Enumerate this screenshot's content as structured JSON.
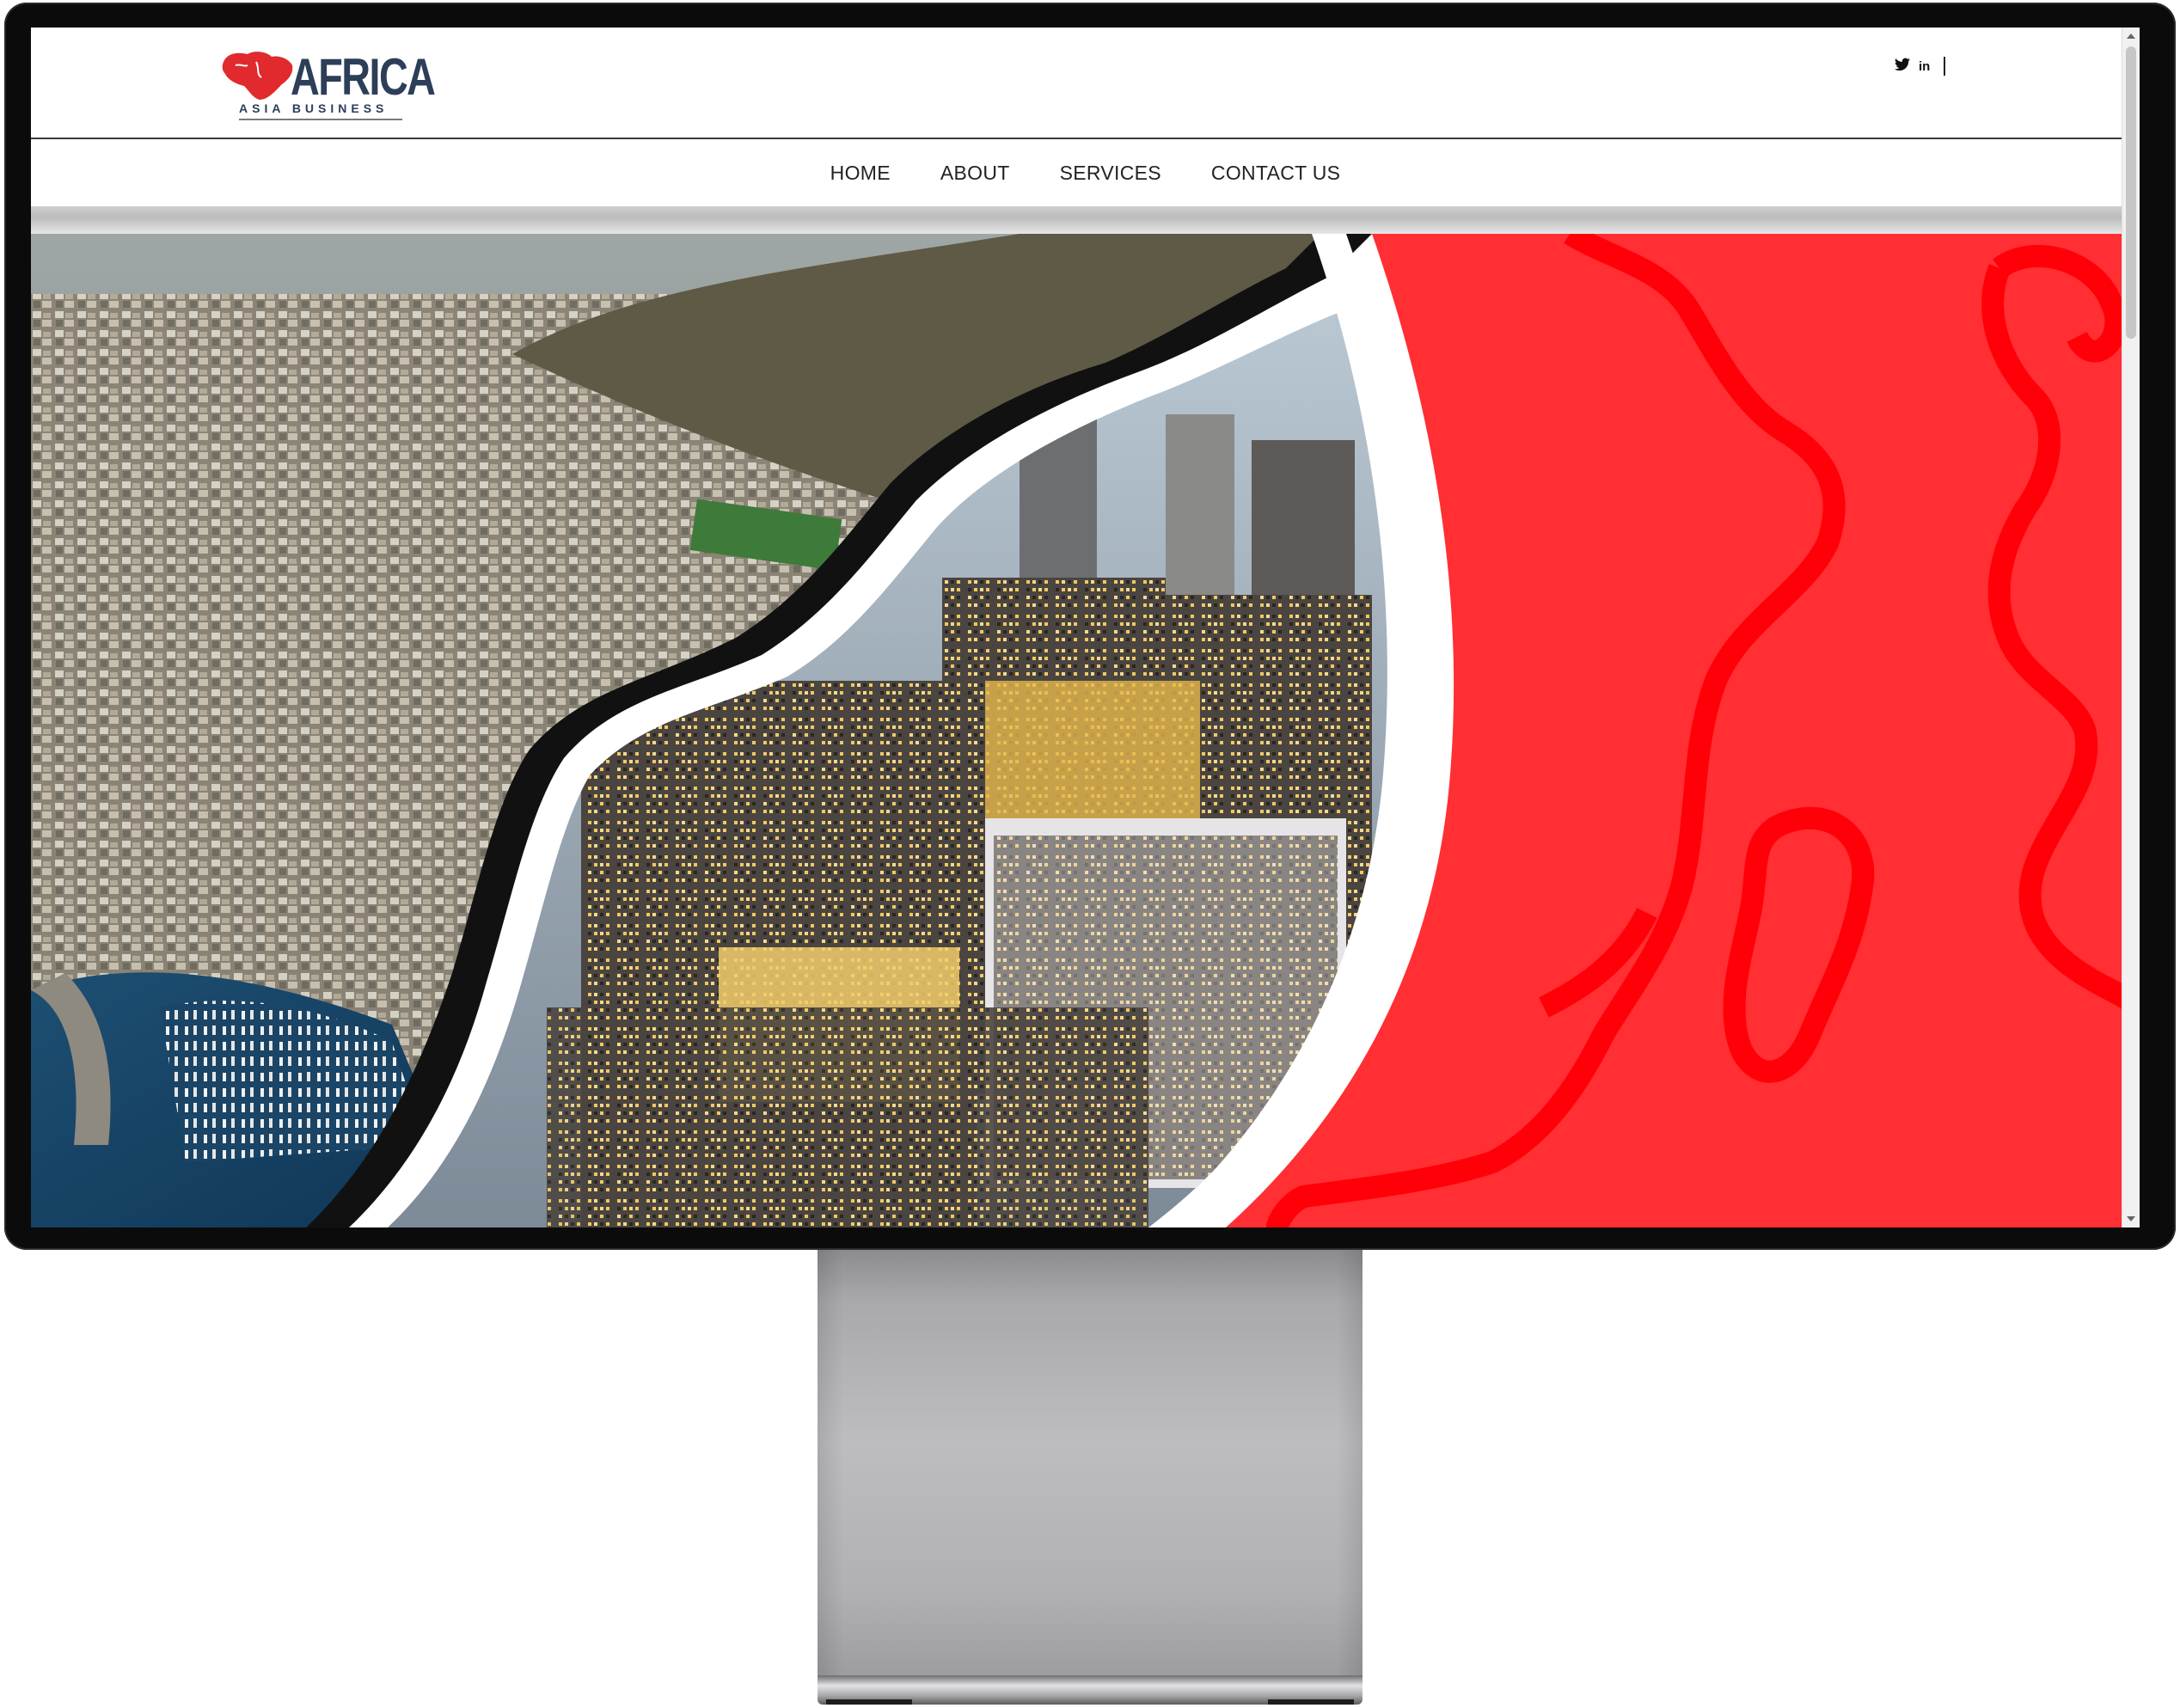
{
  "site": {
    "logo": {
      "word": "AFRICA",
      "tagline": "ASIA BUSINESS"
    },
    "social": {
      "twitter_icon": "twitter-icon",
      "linkedin_label": "in"
    },
    "nav": {
      "items": [
        {
          "label": "HOME"
        },
        {
          "label": "ABOUT"
        },
        {
          "label": "SERVICES"
        },
        {
          "label": "CONTACT US"
        }
      ]
    },
    "hero": {
      "left_image": "aerial-harbour-city",
      "center_image": "night-city-skyline",
      "right_panel": "africa-map-outline"
    },
    "colors": {
      "brand_red": "#ff2f33",
      "map_outline": "#ff0008",
      "logo_navy": "#2c3e58"
    }
  }
}
